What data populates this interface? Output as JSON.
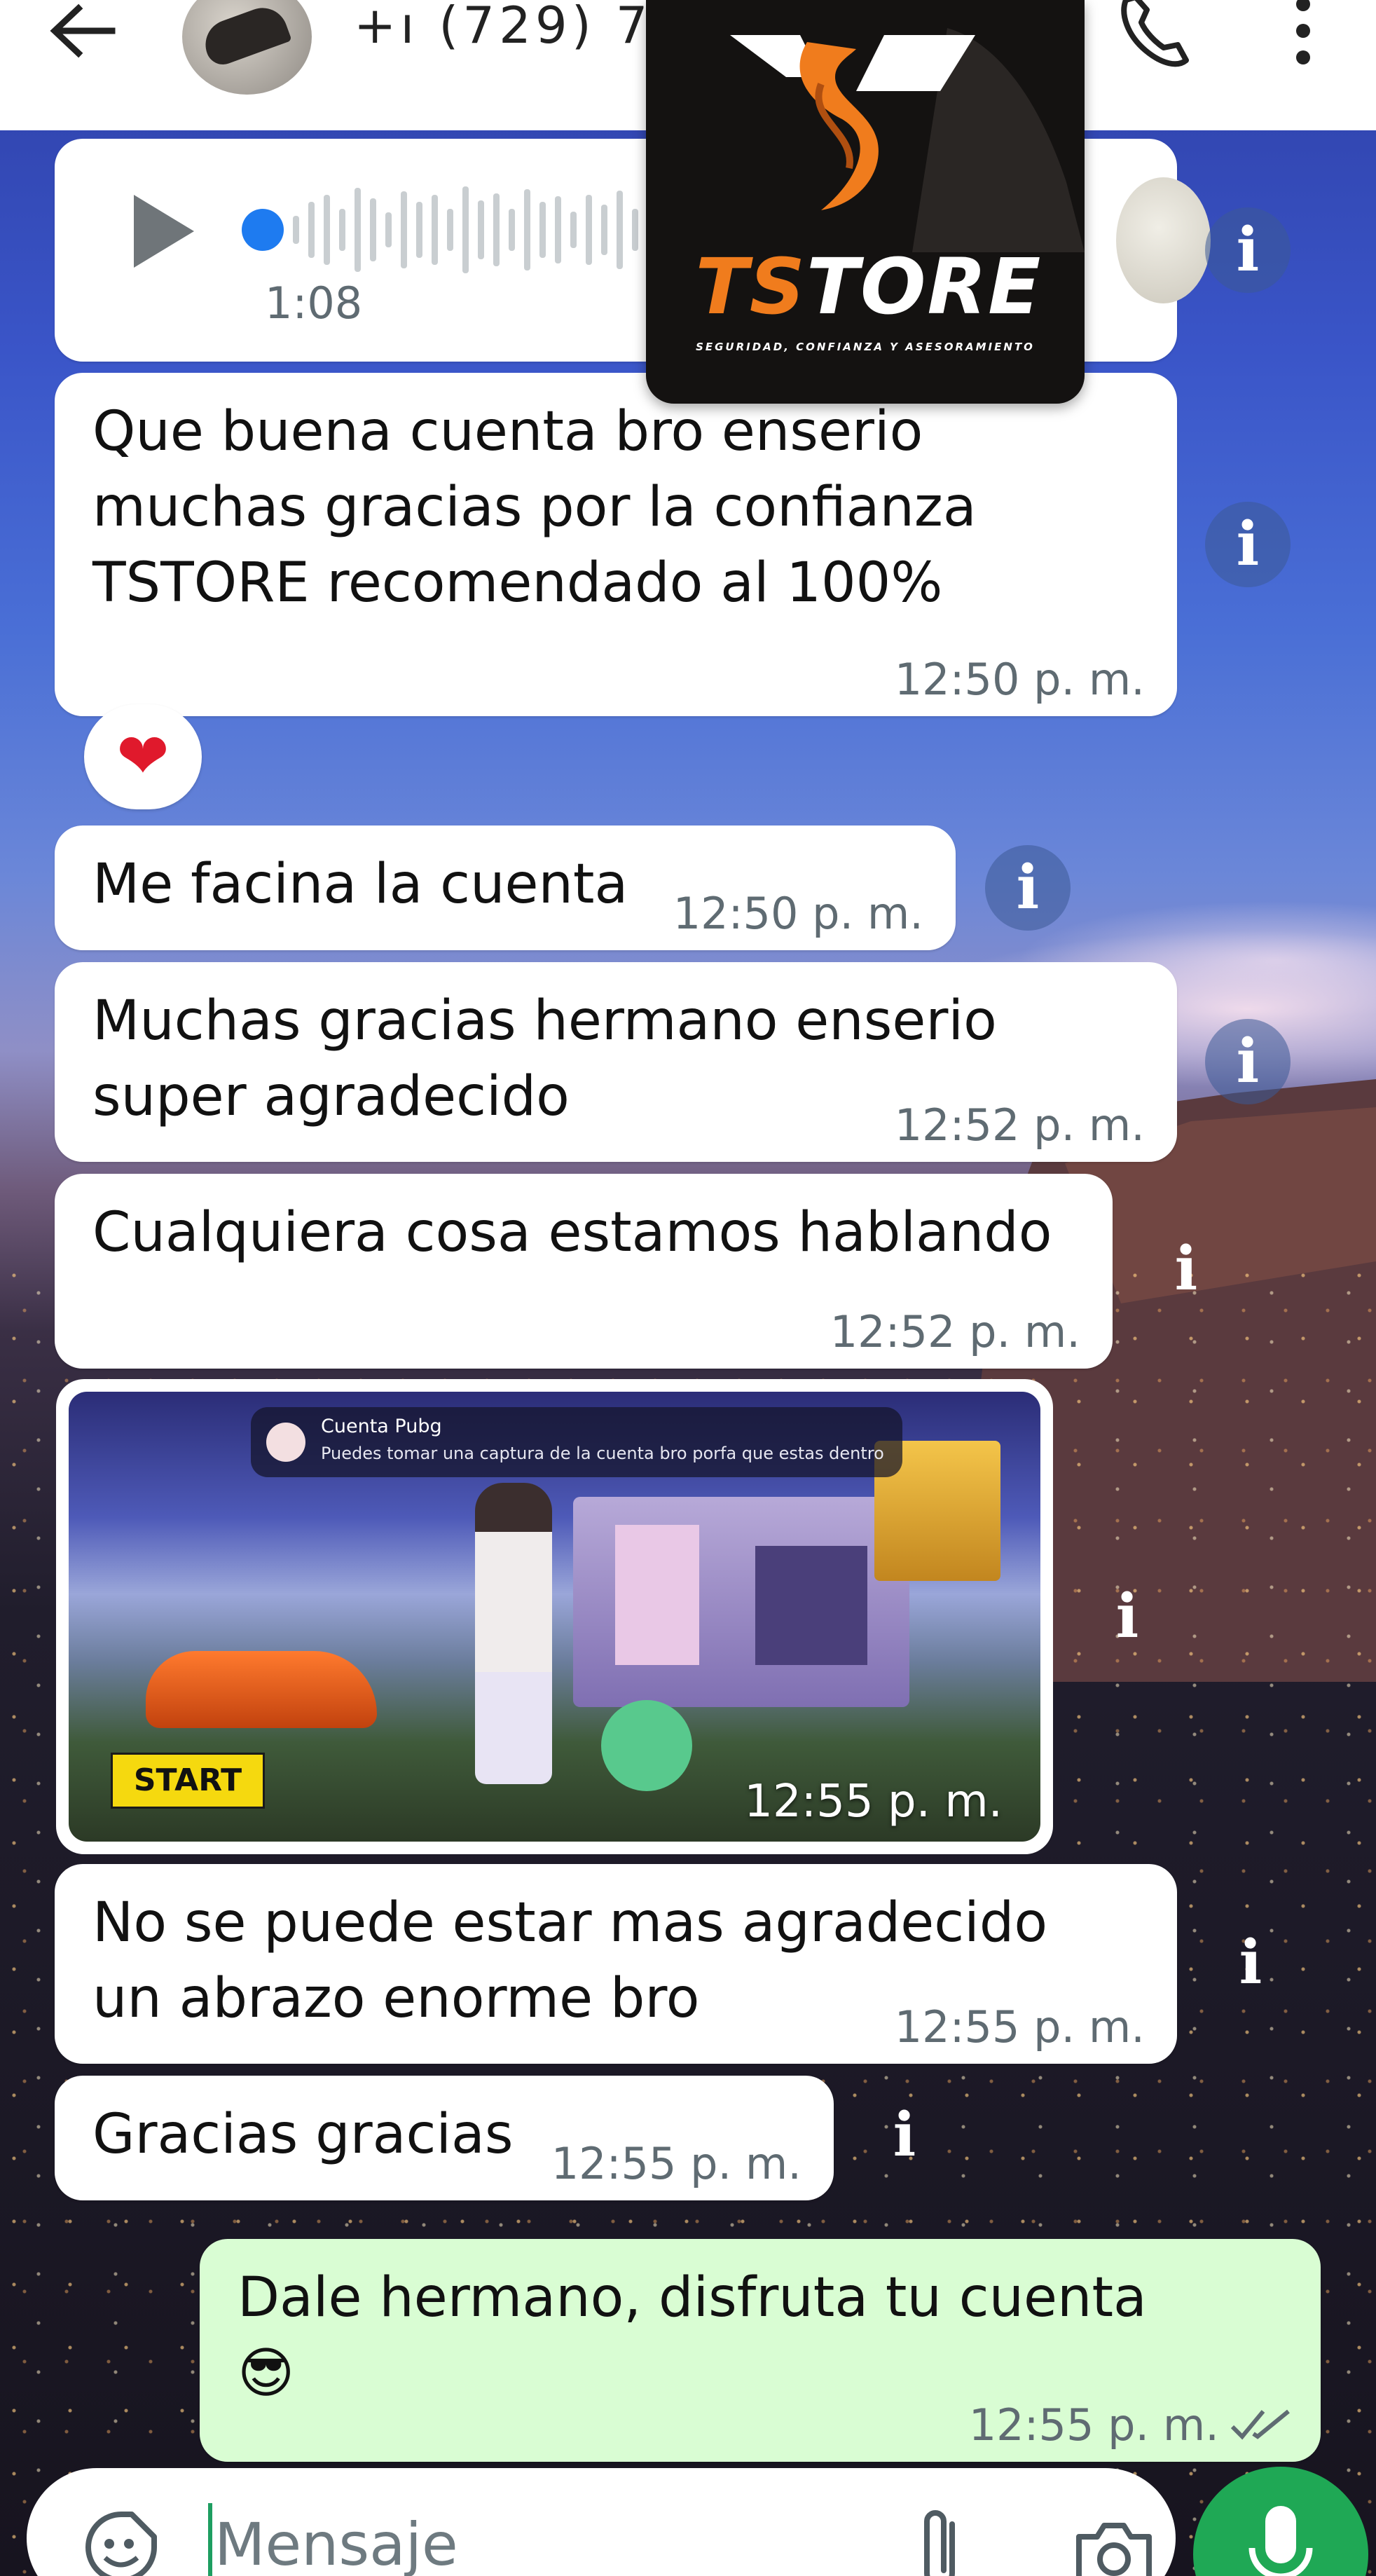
{
  "header": {
    "contact_name": "+ı (729) 7",
    "icons": {
      "back": "arrow-left-icon",
      "call": "phone-icon",
      "more": "more-vertical-icon"
    }
  },
  "logo": {
    "brand_left": "TS",
    "brand_right": "TORE",
    "tagline": "SEGURIDAD, CONFIANZA Y ASESORAMIENTO"
  },
  "messages": {
    "voice": {
      "duration": "1:08"
    },
    "m1": {
      "text": "Que buena cuenta bro enserio\nmuchas gracias por la confianza\nTSTORE recomendado al 100%",
      "time": "12:50 p. m."
    },
    "m1_reaction": "❤",
    "m2": {
      "text": "Me facina la cuenta",
      "time": "12:50 p. m."
    },
    "m3": {
      "text": "Muchas gracias hermano enserio\nsuper agradecido",
      "time": "12:52 p. m."
    },
    "m4": {
      "text": "Cualquiera cosa estamos hablando",
      "time": "12:52 p. m."
    },
    "image": {
      "time": "12:55 p. m.",
      "notif_title": "Cuenta Pubg",
      "notif_body": "Puedes tomar una captura de la cuenta bro porfa que estas dentro",
      "start_label": "START"
    },
    "m5": {
      "text": "No se puede estar mas agradecido\nun abrazo enorme bro",
      "time": "12:55 p. m."
    },
    "m6": {
      "text": "Gracias gracias",
      "time": "12:55 p. m."
    },
    "m7": {
      "text": "Dale hermano, disfruta tu cuenta\n😎",
      "time": "12:55 p. m.",
      "status": "read"
    }
  },
  "info_label": "i",
  "composer": {
    "placeholder": "Mensaje",
    "icons": {
      "emoji": "sticker-emoji-icon",
      "attach": "paperclip-icon",
      "camera": "camera-icon",
      "mic": "microphone-icon"
    }
  },
  "colors": {
    "outgoing_bubble": "#d9fdd3",
    "incoming_bubble": "#ffffff",
    "accent_green": "#1fa855",
    "voice_dot": "#1e7bf0",
    "brand_orange": "#f07c1d"
  }
}
